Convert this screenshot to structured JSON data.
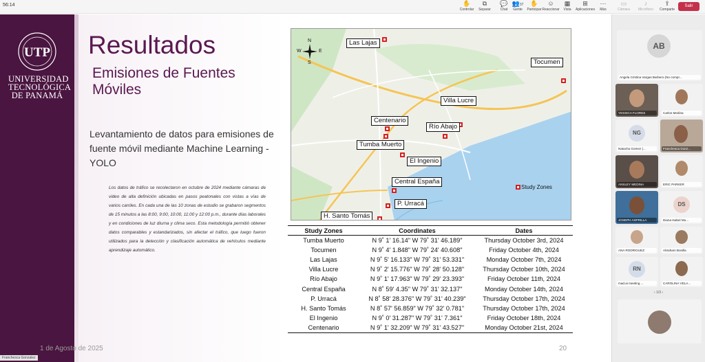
{
  "meeting": {
    "time": "56:14",
    "toolbar": [
      {
        "label": "Controlar",
        "icon": "control-icon"
      },
      {
        "label": "Separar",
        "icon": "popout-icon"
      },
      {
        "label": "Chat",
        "icon": "chat-icon"
      },
      {
        "label": "Gente",
        "icon": "people-icon",
        "badge": "37"
      },
      {
        "label": "Participar",
        "icon": "raise-hand-icon"
      },
      {
        "label": "Reaccionar",
        "icon": "react-icon"
      },
      {
        "label": "Vista",
        "icon": "view-icon"
      },
      {
        "label": "Aplicaciones",
        "icon": "apps-icon"
      },
      {
        "label": "Más",
        "icon": "more-icon"
      },
      {
        "label": "Cámara",
        "icon": "camera-icon"
      },
      {
        "label": "Micrófono",
        "icon": "mic-icon"
      },
      {
        "label": "Comparte",
        "icon": "share-icon"
      }
    ],
    "leave_label": "Salir"
  },
  "slide": {
    "university": "UNIVERSIDAD TECNOLÓGICA DE PANAMÁ",
    "logo_text": "UTP",
    "title": "Resultados",
    "subtitle": "Emisiones de Fuentes Móviles",
    "lead": "Levantamiento de datos para emisiones de fuente móvil mediante Machine Learning - YOLO",
    "paragraph": "Los datos de tráfico se recolectaron en octubre de 2024 mediante cámaras de video de alta definición ubicadas en pasos peatonales con vistas a vías de varios carriles. En cada una de las 10 zonas de estudio se grabaron segmentos de 15 minutos a las 8:00, 9:00, 10:00, 11:00 y 12:00 p.m., durante días laborales y en condiciones de luz diurna y clima seco. Esta metodología permitió obtener datos comparables y estandarizados, sin afectar el tráfico, que luego fueron utilizados para la detección y clasificación automática de vehículos mediante aprendizaje automático.",
    "date": "1 de Agosto de 2025",
    "page_number": "20",
    "map": {
      "labels": {
        "las_lajas": "Las Lajas",
        "tocumen": "Tocumen",
        "villa_lucre": "Villa Lucre",
        "centenario": "Centenario",
        "rio_abajo": "Río Abajo",
        "tumba_muerto": "Tumba Muerto",
        "el_ingenio": "El Ingenio",
        "central_espana": "Central España",
        "p_urraca": "P. Urracá",
        "h_santo_tomas": "H. Santo Tomás"
      },
      "legend": "Study Zones",
      "compass": {
        "n": "N",
        "s": "S",
        "e": "E",
        "w": "W"
      }
    },
    "table": {
      "headers": [
        "Study Zones",
        "Coordinates",
        "Dates"
      ],
      "rows": [
        [
          "Tumba Muerto",
          "N 9˚ 1' 16.14\" W 79˚ 31' 46.189\"",
          "Thursday October 3rd, 2024"
        ],
        [
          "Tocumen",
          "N 9˚ 4' 1.848\" W 79˚ 24' 40.608\"",
          "Friday October 4th, 2024"
        ],
        [
          "Las Lajas",
          "N 9˚ 5' 16.133\" W 79˚ 31' 53.331\"",
          "Monday October 7th, 2024"
        ],
        [
          "Villa Lucre",
          "N 9˚ 2' 15.776\" W 79˚ 28' 50.128\"",
          "Thursday October 10th, 2024"
        ],
        [
          "Río Abajo",
          "N 9˚ 1' 17.963\" W 79˚ 29' 23.393\"",
          "Friday October 11th, 2024"
        ],
        [
          "Central España",
          "N 8˚ 59' 4.35\" W 79˚ 31' 32.137\"",
          "Monday October 14th, 2024"
        ],
        [
          "P. Urracá",
          "N 8˚ 58' 28.376\" W 79˚ 31' 40.239\"",
          "Thursday October 17th, 2024"
        ],
        [
          "H. Santo Tomás",
          "N 8˚ 57' 56.859\" W 79˚ 32' 0.781\"",
          "Thursday October 17th, 2024"
        ],
        [
          "El Ingenio",
          "N 9˚ 0' 31.287\" W 79˚ 31' 7.361\"",
          "Friday October 18th, 2024"
        ],
        [
          "Centenario",
          "N 9˚ 1' 32.209\" W 79˚ 31' 43.527\"",
          "Monday October 21st, 2024"
        ]
      ]
    }
  },
  "participants": {
    "tiles": [
      {
        "name": "Angela Cristina Vargas Barbero (No compr...",
        "initials": "AB"
      },
      {
        "name": "YESSICA FLORES",
        "initials": ""
      },
      {
        "name": "Carlos Medina",
        "initials": ""
      },
      {
        "name": "Natacha Gomez (...",
        "initials": "NG"
      },
      {
        "name": "Franchesca Gonz...",
        "initials": ""
      },
      {
        "name": "ANSLEY MEDINA",
        "initials": ""
      },
      {
        "name": "ERIC PARKER",
        "initials": ""
      },
      {
        "name": "JOSEPH ASPRILLA",
        "initials": ""
      },
      {
        "name": "Diana Isabel Mu...",
        "initials": "DS"
      },
      {
        "name": "ANA RODRIGUEZ",
        "initials": ""
      },
      {
        "name": "Abraham Bonilla",
        "initials": ""
      },
      {
        "name": "mad.ai meeting ...",
        "initials": "RN"
      },
      {
        "name": "CAROLINA VELA...",
        "initials": ""
      }
    ],
    "pager": "1/3",
    "presenter": "Franchesca Gonzalez"
  }
}
